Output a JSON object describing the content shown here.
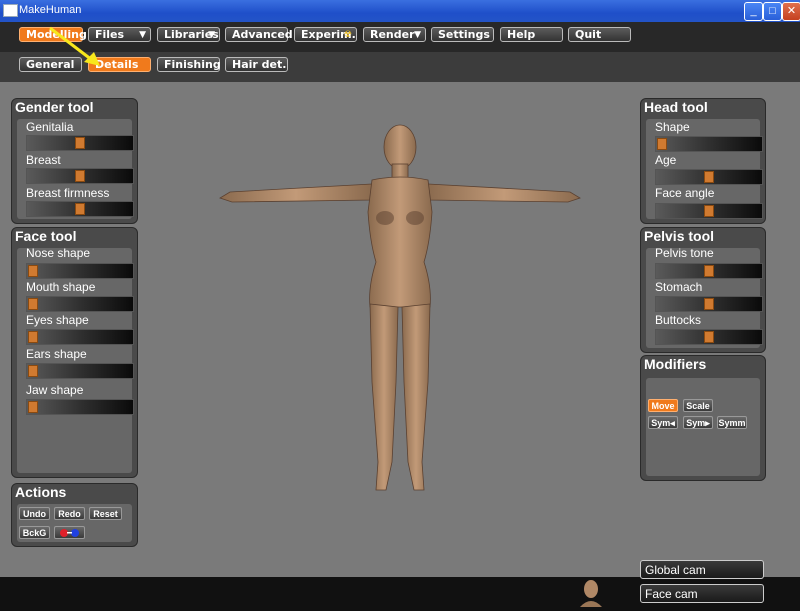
{
  "window": {
    "title": "MakeHuman",
    "min": "_",
    "max": "□",
    "close": "✕"
  },
  "menu": [
    {
      "label": "Modelling",
      "active": true
    },
    {
      "label": "Files",
      "arrow": "▼"
    },
    {
      "label": "Libraries",
      "arrow": "▼"
    },
    {
      "label": "Advanced"
    },
    {
      "label": "Experim.",
      "arrow": "☢"
    },
    {
      "label": "Render",
      "arrow": "▼"
    },
    {
      "label": "Settings"
    },
    {
      "label": "Help"
    },
    {
      "label": "Quit"
    }
  ],
  "subtabs": [
    {
      "label": "General"
    },
    {
      "label": "Details",
      "active": true
    },
    {
      "label": "Finishing"
    },
    {
      "label": "Hair det."
    }
  ],
  "gender_tool": {
    "title": "Gender tool",
    "sliders": [
      {
        "label": "Genitalia",
        "value": 0.5
      },
      {
        "label": "Breast",
        "value": 0.5
      },
      {
        "label": "Breast firmness",
        "value": 0.5
      }
    ]
  },
  "face_tool": {
    "title": "Face tool",
    "sliders": [
      {
        "label": "Nose shape",
        "value": 0.0
      },
      {
        "label": "Mouth shape",
        "value": 0.0
      },
      {
        "label": "Eyes shape",
        "value": 0.0
      },
      {
        "label": "Ears shape",
        "value": 0.0
      },
      {
        "label": "Jaw shape",
        "value": 0.0
      }
    ]
  },
  "actions": {
    "title": "Actions",
    "undo": "Undo",
    "redo": "Redo",
    "reset": "Reset",
    "bckg": "BckG"
  },
  "head_tool": {
    "title": "Head tool",
    "sliders": [
      {
        "label": "Shape",
        "value": 0.0
      },
      {
        "label": "Age",
        "value": 0.5
      },
      {
        "label": "Face angle",
        "value": 0.5
      }
    ]
  },
  "pelvis_tool": {
    "title": "Pelvis tool",
    "sliders": [
      {
        "label": "Pelvis tone",
        "value": 0.5
      },
      {
        "label": "Stomach",
        "value": 0.5
      },
      {
        "label": "Buttocks",
        "value": 0.5
      }
    ]
  },
  "modifiers": {
    "title": "Modifiers",
    "move": "Move",
    "scale": "Scale",
    "sym_left": "Sym◂",
    "sym_right": "Sym▸",
    "symm": "Symm"
  },
  "camera": {
    "global": "Global cam",
    "face": "Face cam"
  },
  "colors": {
    "accent": "#f07a1c",
    "skin": "#b08866",
    "skin_shadow": "#7a5a40"
  }
}
